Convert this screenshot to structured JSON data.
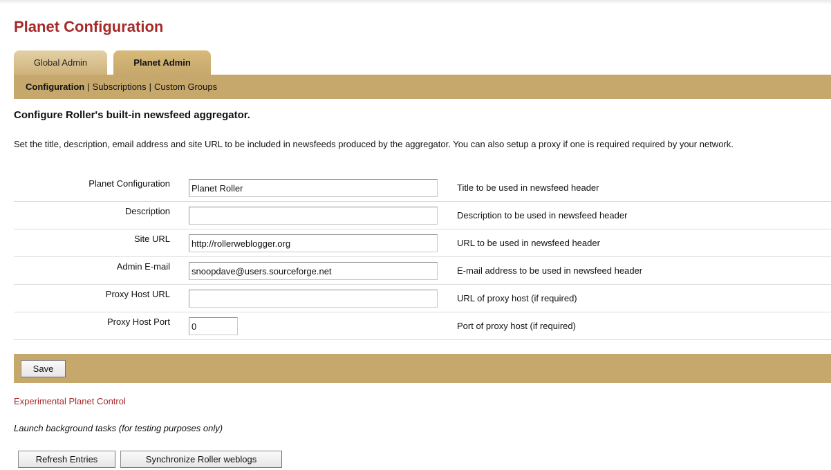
{
  "page": {
    "title": "Planet Configuration"
  },
  "tabs": [
    {
      "label": "Global Admin",
      "active": false
    },
    {
      "label": "Planet Admin",
      "active": true
    }
  ],
  "subnav": {
    "items": [
      "Configuration",
      "Subscriptions",
      "Custom Groups"
    ],
    "separator": "|",
    "selected": "Configuration"
  },
  "section": {
    "heading": "Configure Roller's built-in newsfeed aggregator.",
    "intro": "Set the title, description, email address and site URL to be included in newsfeeds produced by the aggregator. You can also setup a proxy if one is required required by your network."
  },
  "form": {
    "rows": [
      {
        "label": "Planet Configuration",
        "value": "Planet Roller",
        "help": "Title to be used in newsfeed header"
      },
      {
        "label": "Description",
        "value": "",
        "help": "Description to be used in newsfeed header"
      },
      {
        "label": "Site URL",
        "value": "http://rollerweblogger.org",
        "help": "URL to be used in newsfeed header"
      },
      {
        "label": "Admin E-mail",
        "value": "snoopdave@users.sourceforge.net",
        "help": "E-mail address to be used in newsfeed header"
      },
      {
        "label": "Proxy Host URL",
        "value": "",
        "help": "URL of proxy host (if required)"
      },
      {
        "label": "Proxy Host Port",
        "value": "0",
        "help": "Port of proxy host (if required)"
      }
    ],
    "save_label": "Save"
  },
  "experimental": {
    "link": "Experimental Planet Control",
    "description": "Launch background tasks (for testing purposes only)",
    "refresh_label": "Refresh Entries",
    "sync_label": "Synchronize Roller weblogs"
  },
  "colors": {
    "accent": "#a62a2a",
    "bar": "#c6a86d",
    "tab_inactive": "#d9c08f"
  }
}
